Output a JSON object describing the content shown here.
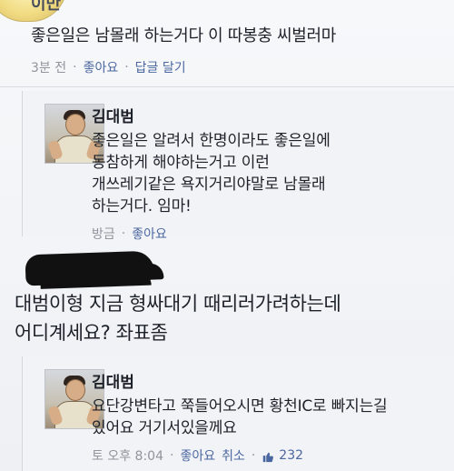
{
  "top_comment": {
    "partial_name": "이만",
    "text": "좋은일은 남몰래 하는거다 이 따봉충 씨벌러마",
    "meta": {
      "time": "3분 전",
      "like": "좋아요",
      "reply": "답글 달기"
    }
  },
  "reply_1": {
    "name": "김대범",
    "lines": [
      "좋은일은 알려서 한명이라도 좋은일에",
      "동참하게 해야하는거고 이런",
      "개쓰레기같은 욕지거리야말로 남몰래",
      "하는거다. 임마!"
    ],
    "meta": {
      "time": "방금",
      "like": "좋아요"
    }
  },
  "middle_comment": {
    "lines": [
      "대범이형 지금 형싸대기 때리러가려하는데",
      "어디계세요? 좌표좀"
    ]
  },
  "reply_2": {
    "name": "김대범",
    "lines": [
      "요단강변타고 쭉들어오시면 황천IC로 빠지는길",
      "있어요 거기서있을께요"
    ],
    "meta": {
      "time": "토 오후 8:04",
      "like": "좋아요",
      "cancel": "취소",
      "count": "232"
    }
  },
  "icons": {
    "like": "thumbs-up-icon"
  },
  "colors": {
    "link": "#4b67a1",
    "meta": "#90949c",
    "text": "#1d2129"
  }
}
